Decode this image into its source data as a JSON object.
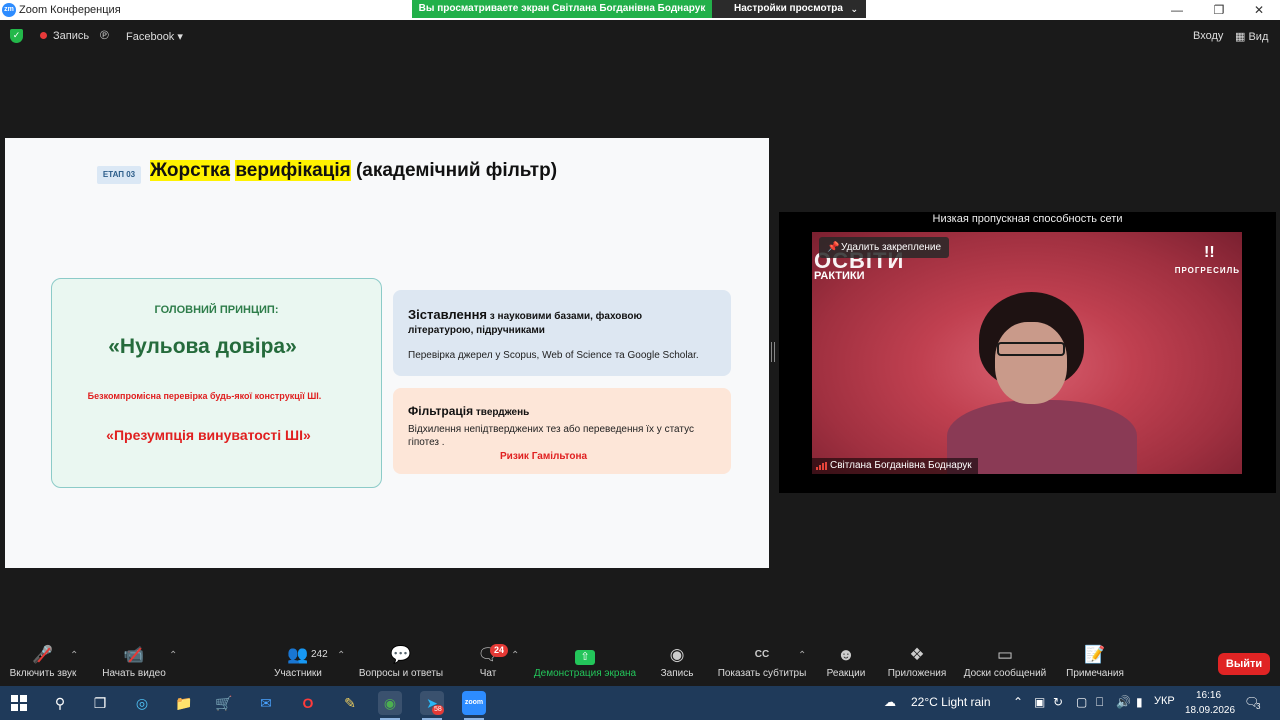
{
  "window": {
    "app_icon": "zm",
    "title": "Zoom Конференция",
    "share_banner": "Вы просматриваете экран Світлана Богданівна Боднарук",
    "view_settings": "Настройки просмотра"
  },
  "topbar": {
    "record_label": "Запись",
    "facebook_label": "Facebook",
    "enter_label": "Входу",
    "view_label": "Вид"
  },
  "slide": {
    "stage_badge": "ЕТАП 03",
    "title_part1": "Жорстка",
    "title_part2": "верифікація",
    "title_part3": "(академічний фільтр)",
    "left_card": {
      "heading": "ГОЛОВНИЙ ПРИНЦИП:",
      "main": "«Нульова довіра»",
      "subtext": "Безкомпромісна перевірка будь-якої конструкції ШІ.",
      "presumption": "«Презумпція винуватості ШІ»"
    },
    "card1": {
      "head_big": "Зіставлення",
      "head_rest": "з науковими базами, фаховою літературою,  підручниками",
      "body": "Перевірка джерел у Scopus, Web of Science та Google Scholar."
    },
    "card2": {
      "head_big": "Фільтрація",
      "head_rest": "тверджень",
      "body": "Відхилення непідтверджених тез або переведення їх у статус гіпотез .",
      "risk": "Ризик Гамільтона"
    }
  },
  "video": {
    "network_warning": "Низкая пропускная способность сети",
    "unpin_label": "Удалить закрепление",
    "bg_text_1": "ОСВІТИ",
    "bg_text_2": "РАКТИКИ",
    "logo_mark": "!!",
    "logo_text": "ПРОГРЕСИЛЬ",
    "participant_name": "Світлана Богданівна Боднарук"
  },
  "toolbar": {
    "audio_label": "Включить звук",
    "video_label": "Начать видео",
    "participants_label": "Участники",
    "participants_count": "242",
    "qa_label": "Вопросы и ответы",
    "chat_label": "Чат",
    "chat_badge": "24",
    "share_label": "Демонстрация экрана",
    "record_label": "Запись",
    "subtitles_label": "Показать субтитры",
    "subtitles_icon": "CC",
    "reactions_label": "Реакции",
    "apps_label": "Приложения",
    "boards_label": "Доски сообщений",
    "notes_label": "Примечания",
    "exit_label": "Выйти"
  },
  "taskbar": {
    "telegram_badge": "58",
    "zoom_label": "zoom",
    "weather": "22°C  Light rain",
    "language": "УКР",
    "time": "16:16",
    "date": "18.09.2026",
    "notification_count": "3"
  },
  "colors": {
    "accent_green": "#23c55a",
    "danger_red": "#e02424",
    "highlight_yellow": "#fff200",
    "taskbar_blue": "#1f3a5a"
  }
}
